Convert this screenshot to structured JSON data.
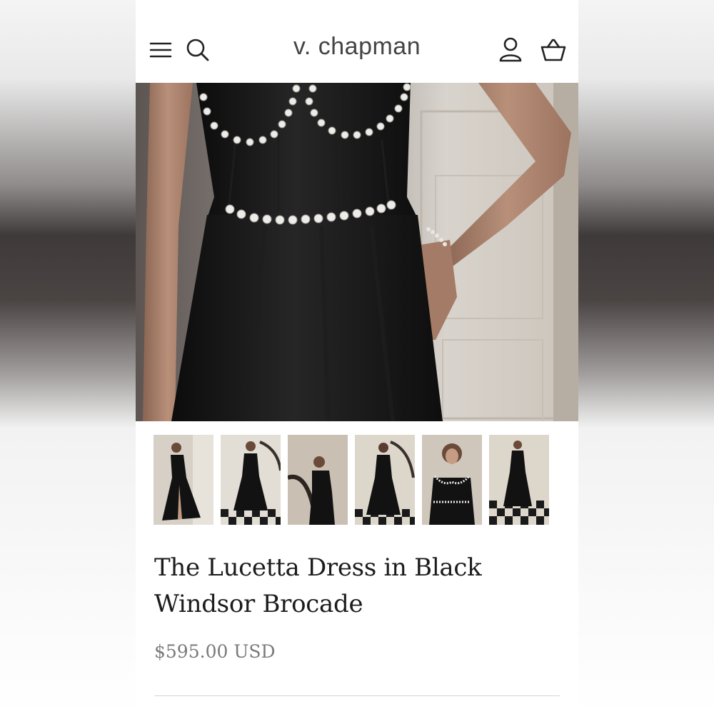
{
  "header": {
    "logo_text": "v. chapman",
    "menu_icon": "hamburger-menu-icon",
    "search_icon": "search-icon",
    "account_icon": "user-account-icon",
    "cart_icon": "shopping-basket-icon"
  },
  "product": {
    "title": "The Lucetta Dress in Black Windsor Brocade",
    "price": "$595.00 USD"
  },
  "gallery": {
    "thumbnail_count": 6,
    "selected_index": 0
  },
  "colors": {
    "dress": "#141414",
    "pearl": "#e8e6e2",
    "wall": "#d9d4cc",
    "text_primary": "#1c1c1c",
    "text_muted": "#7a7a7a"
  }
}
